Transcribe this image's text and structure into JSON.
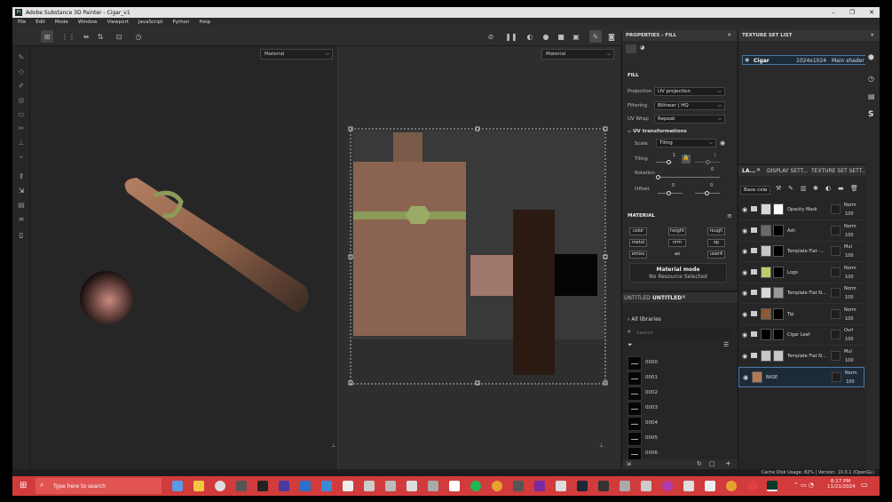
{
  "window": {
    "title": "Adobe Substance 3D Painter - Cigar_v1",
    "logo_text": "Pt",
    "min": "–",
    "max": "❐",
    "close": "✕"
  },
  "menu": [
    "File",
    "Edit",
    "Mode",
    "Window",
    "Viewport",
    "JavaScript",
    "Python",
    "Help"
  ],
  "viewport": {
    "left_mode": "Material",
    "right_mode": "Material",
    "chevron": "⌵"
  },
  "properties": {
    "title": "PROPERTIES - FILL",
    "section": "FILL",
    "projection_label": "Projection",
    "projection_value": "UV projection",
    "filtering_label": "Filtering",
    "filtering_value": "Bilinear | HQ",
    "uvwrap_label": "UV Wrap",
    "uvwrap_value": "Repeat",
    "uvtrans_label": "UV transformations",
    "scale_label": "Scale",
    "scale_value": "Tiling",
    "tiling_label": "Tiling",
    "tiling_v1": "1",
    "tiling_v2": "1",
    "rotation_label": "Rotation",
    "rotation_v": "0",
    "offset_label": "Offset",
    "offset_v1": "0",
    "offset_v2": "0",
    "material_label": "MATERIAL",
    "channels": [
      "color",
      "height",
      "rough",
      "metal",
      "nrm",
      "op",
      "emiss",
      "ao",
      "user4"
    ],
    "material_mode_label": "Material mode",
    "material_mode_value": "No Resource Selected"
  },
  "shelf": {
    "tab1": "UNTITLED",
    "tab2": "UNTITLED",
    "all_libraries": "All libraries",
    "search_placeholder": "Search",
    "items": [
      "0000",
      "0001",
      "0002",
      "0003",
      "0004",
      "0005",
      "0006"
    ]
  },
  "texture_set_list": {
    "title": "TEXTURE SET LIST",
    "name": "Cigar",
    "resolution": "1024x1024",
    "shader": "Main shader"
  },
  "layers": {
    "tabs": [
      "LA...",
      "DISPLAY SETT...",
      "TEXTURE SET SETT..."
    ],
    "blend_select": "Base colo",
    "items": [
      {
        "name": "Opacity Mask",
        "blend": "Norm",
        "opacity": "100",
        "color1": "#d8d8d8",
        "color2": "#ffffff"
      },
      {
        "name": "Ash",
        "blend": "Norm",
        "opacity": "100",
        "color1": "#6a6a6a",
        "color2": "#000000"
      },
      {
        "name": "Template Flat -...",
        "blend": "Mul",
        "opacity": "100",
        "color1": "#c8c8c8",
        "color2": "#000000"
      },
      {
        "name": "Logo",
        "blend": "Norm",
        "opacity": "100",
        "color1": "#b9cf6a",
        "color2": "#000000"
      },
      {
        "name": "Template Flat N...",
        "blend": "Norm",
        "opacity": "100",
        "color1": "#d8d8d8",
        "color2": "#9a9a9a"
      },
      {
        "name": "Tip",
        "blend": "Norm",
        "opacity": "100",
        "color1": "#8a5a3a",
        "color2": "#000000"
      },
      {
        "name": "Cigar Leaf",
        "blend": "Ovrl",
        "opacity": "100",
        "color1": "#000000",
        "color2": "#000000"
      },
      {
        "name": "Template Flat N...",
        "blend": "Mul",
        "opacity": "100",
        "color1": "#c8c8c8",
        "color2": "#c8c8c8"
      },
      {
        "name": "BASE",
        "blend": "Norm",
        "opacity": "100",
        "color1": "#b07a55",
        "color2": ""
      }
    ]
  },
  "status": {
    "text": "Cache Disk Usage:   82%  |  Version: 10.0.1 (OpenGL)"
  },
  "taskbar": {
    "search_placeholder": "Type here to search",
    "time": "8:17 PM",
    "date": "11/21/2024"
  }
}
